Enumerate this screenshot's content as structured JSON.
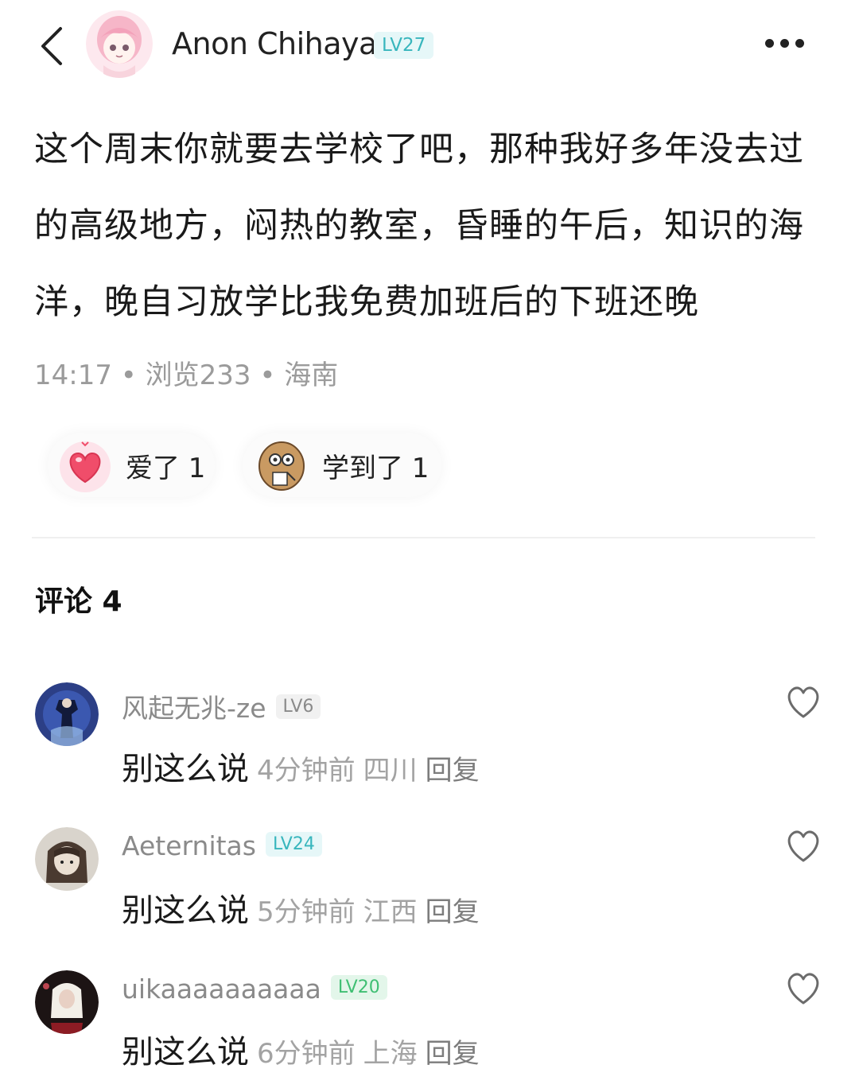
{
  "header": {
    "author_name": "Anon Chihaya",
    "author_level": "LV27"
  },
  "post": {
    "text": "这个周末你就要去学校了吧，那种我好多年没去过的高级地方，闷热的教室，昏睡的午后，知识的海洋，晚自习放学比我免费加班后的下班还晚",
    "meta": "14:17 • 浏览233 • 海南"
  },
  "reactions": [
    {
      "label": "爱了 1",
      "icon": "heart-sticker-icon"
    },
    {
      "label": "学到了 1",
      "icon": "potato-notebook-sticker-icon"
    }
  ],
  "comments_title": "评论 4",
  "colors": {
    "level_teal_bg": "#e6f7f8",
    "level_teal_text": "#38b6bd",
    "level_gray_bg": "#f1f1f1",
    "level_gray_text": "#8a8a8a",
    "level_green_bg": "#e3f6ea",
    "level_green_text": "#3fbf73"
  },
  "comments": [
    {
      "name": "风起无兆-ze",
      "level": "LV6",
      "text": "别这么说",
      "time": "4分钟前",
      "region": "四川",
      "reply": "回复"
    },
    {
      "name": "Aeternitas",
      "level": "LV24",
      "text": "别这么说",
      "time": "5分钟前",
      "region": "江西",
      "reply": "回复"
    },
    {
      "name": "uikaaaaaaaaaa",
      "level": "LV20",
      "text": "别这么说",
      "time": "6分钟前",
      "region": "上海",
      "reply": "回复"
    }
  ]
}
